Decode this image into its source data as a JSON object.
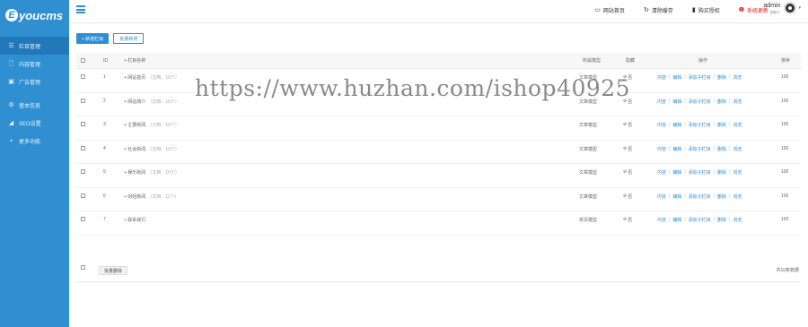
{
  "brand": {
    "logo_mark": "E",
    "logo_text": "youcms"
  },
  "sidebar": {
    "items": [
      {
        "icon": "menu-list-icon",
        "glyph": "☰",
        "label": "栏目管理",
        "active": true
      },
      {
        "icon": "document-icon",
        "glyph": "🗋",
        "label": "内容管理",
        "active": false
      },
      {
        "icon": "image-icon",
        "glyph": "▣",
        "label": "广告管理",
        "active": false
      },
      {
        "icon": "gear-icon",
        "glyph": "⚙",
        "label": "基本信息",
        "active": false
      },
      {
        "icon": "send-icon",
        "glyph": "◢",
        "label": "SEO设置",
        "active": false
      },
      {
        "icon": "more-icon",
        "glyph": "▪",
        "label": "更多功能",
        "active": false
      }
    ]
  },
  "topbar": {
    "links": [
      {
        "icon": "monitor-icon",
        "glyph": "▭",
        "label": "网站首页",
        "alert": false
      },
      {
        "icon": "refresh-icon",
        "glyph": "↻",
        "label": "清除缓存",
        "alert": false
      },
      {
        "icon": "bookmark-icon",
        "glyph": "▮",
        "label": "购买授权",
        "alert": false
      },
      {
        "icon": "alert-icon",
        "glyph": "❶",
        "label": "系统更新",
        "alert": true
      }
    ],
    "user": {
      "name": "admin",
      "role": "创始人"
    }
  },
  "toolbar": {
    "add_label": "+ 新增栏目",
    "batch_add_label": "批量新增"
  },
  "table": {
    "headers": {
      "id": "ID",
      "name": "+ 栏目名称",
      "model": "所属模型",
      "hidden": "隐藏",
      "ops": "操作",
      "sort": "排序"
    },
    "rows": [
      {
        "id": "1",
        "name": "+ 网站首页",
        "sub": "（文档：10个）",
        "model": "文章模型",
        "hidden": "否",
        "sort": "100"
      },
      {
        "id": "2",
        "name": "+ 网站简介",
        "sub": "（文档：10个）",
        "model": "文章模型",
        "hidden": "否",
        "sort": "100"
      },
      {
        "id": "3",
        "name": "+ 主要新闻",
        "sub": "（文档：10个）",
        "model": "文章模型",
        "hidden": "否",
        "sort": "100"
      },
      {
        "id": "4",
        "name": "+ 社会新闻",
        "sub": "（文档：10个）",
        "model": "文章模型",
        "hidden": "否",
        "sort": "100"
      },
      {
        "id": "5",
        "name": "+ 娱乐新闻",
        "sub": "（文档：10个）",
        "model": "文章模型",
        "hidden": "否",
        "sort": "100"
      },
      {
        "id": "6",
        "name": "+ 财经新闻",
        "sub": "（文档：11个）",
        "model": "文章模型",
        "hidden": "否",
        "sort": "100"
      },
      {
        "id": "7",
        "name": "+ 联系我们",
        "sub": "",
        "model": "单页模型",
        "hidden": "否",
        "sort": "100"
      }
    ],
    "ops": [
      "内容",
      "编辑",
      "添加子栏目",
      "删除",
      "浏览"
    ]
  },
  "footer": {
    "batch_delete_label": "批量删除",
    "total": "共10条数据"
  },
  "watermark": "https://www.huzhan.com/ishop40925"
}
